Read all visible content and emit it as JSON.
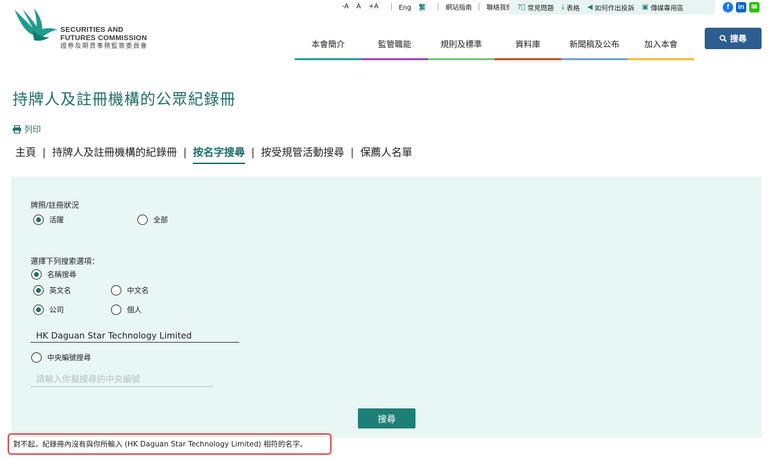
{
  "header": {
    "logo_en_line1": "SECURITIES AND",
    "logo_en_line2": "FUTURES COMMISSION",
    "logo_zh": "證券及期貨事務監察委員會",
    "font_controls": [
      "-A",
      "A",
      "+A"
    ],
    "languages": [
      "Eng",
      "繁"
    ],
    "active_language": "繁",
    "util_links": [
      "網站指南",
      "聯絡我們"
    ],
    "quick_links": [
      {
        "label": "常見問題",
        "icon": "question-circle-icon"
      },
      {
        "label": "表格",
        "icon": "download-icon"
      },
      {
        "label": "如何作出投訴",
        "icon": "megaphone-icon"
      },
      {
        "label": "傳媒專用區",
        "icon": "image-icon"
      }
    ],
    "social": [
      {
        "name": "facebook-icon",
        "glyph": "f",
        "color": "#1877f2"
      },
      {
        "name": "linkedin-icon",
        "glyph": "in",
        "color": "#0a66c2"
      },
      {
        "name": "wechat-icon",
        "glyph": "✉",
        "color": "#2dc100"
      }
    ],
    "search_label": "搜尋",
    "nav": [
      {
        "label": "本會簡介",
        "color": "#2aa399"
      },
      {
        "label": "監管職能",
        "color": "#9d4fb0"
      },
      {
        "label": "規則及標準",
        "color": "#7fc282"
      },
      {
        "label": "資料庫",
        "color": "#c0552a"
      },
      {
        "label": "新聞稿及公布",
        "color": "#7ba7cf"
      },
      {
        "label": "加入本會",
        "color": "#f1bf3c"
      }
    ]
  },
  "page": {
    "title": "持牌人及註冊機構的公眾紀錄冊",
    "print_label": "列印",
    "tabs": [
      {
        "label": "主頁",
        "active": false
      },
      {
        "label": "持牌人及註冊機構的紀錄冊",
        "active": false
      },
      {
        "label": "按名字搜尋",
        "active": true
      },
      {
        "label": "按受規管活動搜尋",
        "active": false
      },
      {
        "label": "保薦人名單",
        "active": false
      }
    ]
  },
  "form": {
    "status_label": "牌照/註冊狀況",
    "status_active": "活躍",
    "status_all": "全部",
    "options_label": "選擇下列搜索選項：",
    "name_search": "名稱搜尋",
    "english_name": "英文名",
    "chinese_name": "中文名",
    "company": "公司",
    "individual": "個人",
    "name_value": "HK Daguan Star Technology Limited",
    "ce_search": "中央編號搜尋",
    "ce_placeholder": "請輸入你擬搜尋的中央編號",
    "submit_label": "搜尋"
  },
  "message": {
    "error": "對不起，紀錄冊內沒有與你所輸入 (HK Daguan Star Technology Limited) 相符的名字。"
  }
}
